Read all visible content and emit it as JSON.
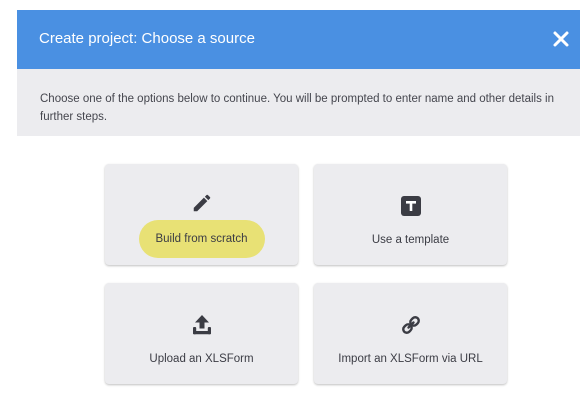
{
  "header": {
    "title": "Create project: Choose a source",
    "close_icon": "close-icon"
  },
  "subheader": {
    "text": "Choose one of the options below to continue. You will be prompted to enter name and other details in further steps."
  },
  "options": [
    {
      "label": "Build from scratch",
      "icon": "pencil-icon",
      "highlighted": true
    },
    {
      "label": "Use a template",
      "icon": "template-icon",
      "highlighted": false
    },
    {
      "label": "Upload an XLSForm",
      "icon": "upload-icon",
      "highlighted": false
    },
    {
      "label": "Import an XLSForm via URL",
      "icon": "link-icon",
      "highlighted": false
    }
  ],
  "colors": {
    "header_bg": "#4a90e2",
    "subheader_bg": "#ececef",
    "card_bg": "#ececef",
    "highlight": "#e8e175",
    "icon": "#3b3c44"
  }
}
